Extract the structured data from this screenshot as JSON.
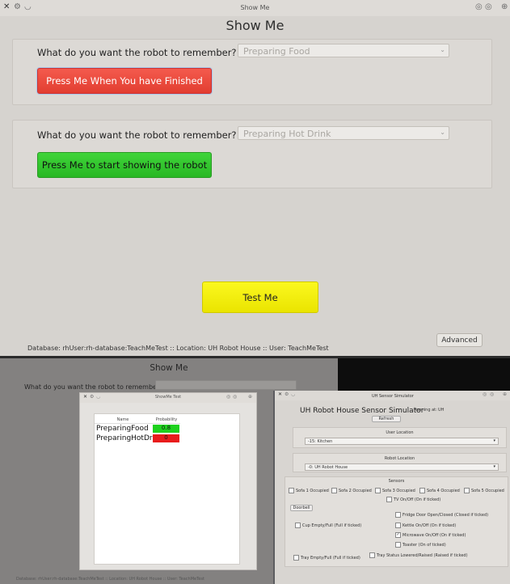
{
  "top_window": {
    "title": "Show Me",
    "heading": "Show Me",
    "section1": {
      "question": "What do you want the robot to remember?",
      "combo_value": "Preparing Food",
      "button_label": "Press Me When You have Finished"
    },
    "section2": {
      "question": "What do you want the robot to remember?",
      "combo_value": "Preparing Hot Drink",
      "button_label": "Press Me to start showing the robot"
    },
    "test_button": "Test Me",
    "advanced_button": "Advanced",
    "status": "Database: rhUser:rh-database:TeachMeTest :: Location: UH Robot House :: User: TeachMeTest"
  },
  "bottom_left": {
    "heading": "Show Me",
    "question": "What do you want the robot to remember?",
    "status": "Database: rhUser:rh-database:TeachMeTest :: Location: UH Robot House :: User: TeachMeTest"
  },
  "showme_dialog": {
    "title": "ShowMe Test",
    "col_name": "Name",
    "col_prob": "Probability",
    "rows": [
      {
        "name": "PreparingFood",
        "prob": "0.8",
        "color": "#1dd11d"
      },
      {
        "name": "PreparingHotDrink",
        "prob": "0",
        "color": "#e81c1c"
      }
    ]
  },
  "simulator": {
    "window_title": "UH Sensor Simulator",
    "title": "UH Robot House Sensor Simulator",
    "running_label": "Running at:",
    "running_value": "UH",
    "refresh": "Refresh",
    "user_location_label": "User Location",
    "user_location_value": "-15: Kitchen",
    "robot_location_label": "Robot Location",
    "robot_location_value": "-0: UH Robot House",
    "sensors_label": "Sensors",
    "sofa_sensors": [
      "Sofa 1 Occupied",
      "Sofa 2 Occupied",
      "Sofa 3 Occupied",
      "Sofa 4 Occupied",
      "Sofa 5 Occupied"
    ],
    "tv": "TV On/Off (On if ticked)",
    "doorbell": "Doorbell",
    "fridge": "Fridge Door Open/Closed (Closed if ticked)",
    "cup": "Cup Empty/Full (Full if ticked)",
    "kettle": "Kettle On/Off (On if ticked)",
    "microwave": "Microwave On/Off (On if ticked)",
    "toaster": "Toaster (On of ticked)",
    "tray": "Tray Empty/Full (Full if ticked)",
    "tray_status": "Tray Status Lowered/Raised (Raised if ticked)"
  }
}
